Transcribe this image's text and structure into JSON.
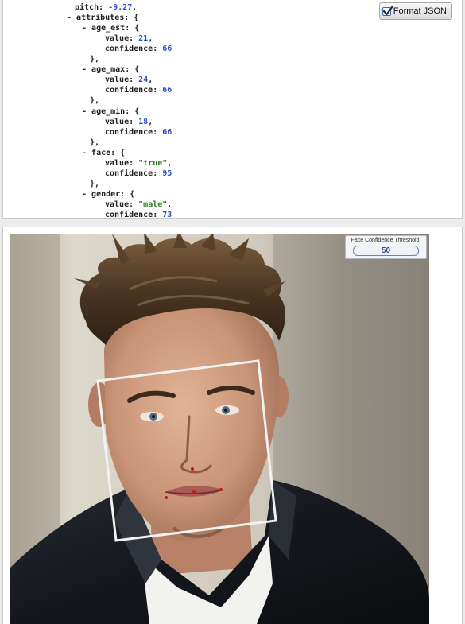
{
  "json_view": {
    "lines": [
      {
        "indent": 1,
        "key": "pitch",
        "value": "-9.27",
        "type": "num",
        "suffix": ","
      },
      {
        "indent": 1,
        "toggle": "-",
        "key": "attributes",
        "open": "{"
      },
      {
        "indent": 2,
        "toggle": "-",
        "key": "age_est",
        "open": "{"
      },
      {
        "indent": 3,
        "key": "value",
        "value": "21",
        "type": "num",
        "suffix": ","
      },
      {
        "indent": 3,
        "key": "confidence",
        "value": "66",
        "type": "num"
      },
      {
        "indent": 2,
        "close": "},"
      },
      {
        "indent": 2,
        "toggle": "-",
        "key": "age_max",
        "open": "{"
      },
      {
        "indent": 3,
        "key": "value",
        "value": "24",
        "type": "num",
        "suffix": ","
      },
      {
        "indent": 3,
        "key": "confidence",
        "value": "66",
        "type": "num"
      },
      {
        "indent": 2,
        "close": "},"
      },
      {
        "indent": 2,
        "toggle": "-",
        "key": "age_min",
        "open": "{"
      },
      {
        "indent": 3,
        "key": "value",
        "value": "18",
        "type": "num",
        "suffix": ","
      },
      {
        "indent": 3,
        "key": "confidence",
        "value": "66",
        "type": "num"
      },
      {
        "indent": 2,
        "close": "},"
      },
      {
        "indent": 2,
        "toggle": "-",
        "key": "face",
        "open": "{"
      },
      {
        "indent": 3,
        "key": "value",
        "value": "\"true\"",
        "type": "str",
        "suffix": ","
      },
      {
        "indent": 3,
        "key": "confidence",
        "value": "95",
        "type": "num"
      },
      {
        "indent": 2,
        "close": "},"
      },
      {
        "indent": 2,
        "toggle": "-",
        "key": "gender",
        "open": "{"
      },
      {
        "indent": 3,
        "key": "value",
        "value": "\"male\"",
        "type": "str",
        "suffix": ","
      },
      {
        "indent": 3,
        "key": "confidence",
        "value": "73",
        "type": "num"
      }
    ]
  },
  "format_toggle": {
    "label": "Format JSON",
    "checked": true
  },
  "threshold": {
    "label": "Face Confidence Threshold:",
    "value": "50"
  },
  "colors": {
    "number": "#2a52be",
    "string": "#2e7d1f",
    "face_box": "#f2f2f2",
    "landmark": "#c21a1a"
  },
  "icons": [
    "checkbox-checked-icon"
  ]
}
